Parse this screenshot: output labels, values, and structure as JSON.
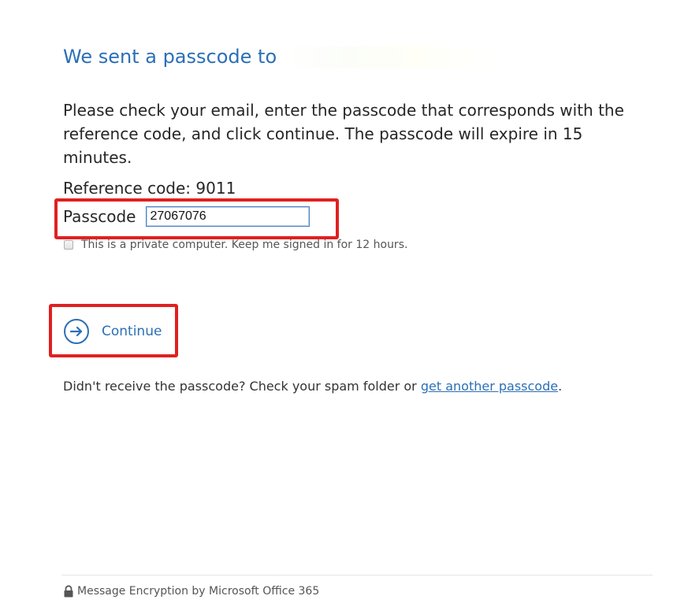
{
  "header": {
    "title": "We sent a passcode to"
  },
  "instructions": "Please check your email, enter the passcode that corresponds with the reference code, and click continue. The passcode will expire in 15 minutes.",
  "reference": {
    "label": "Reference code: 9011"
  },
  "passcode": {
    "label": "Passcode",
    "value": "27067076"
  },
  "remember": {
    "label": "This is a private computer. Keep me signed in for 12 hours."
  },
  "continue_button": {
    "label": "Continue",
    "icon": "arrow-right-circle-icon"
  },
  "resend": {
    "prefix": "Didn't receive the passcode? Check your spam folder or ",
    "link": "get another passcode",
    "suffix": "."
  },
  "footer": {
    "icon": "lock-icon",
    "text": "Message Encryption by Microsoft Office 365"
  },
  "colors": {
    "accent": "#2b6fb6",
    "highlight": "#e02020"
  }
}
